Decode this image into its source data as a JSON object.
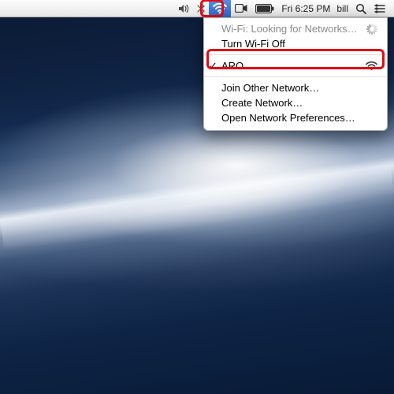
{
  "menubar": {
    "clock": "Fri 6:25 PM",
    "user": "bill"
  },
  "wifi_menu": {
    "status": "Wi-Fi: Looking for Networks…",
    "toggle": "Turn Wi-Fi Off",
    "networks": [
      {
        "name": "ARO",
        "connected": true
      }
    ],
    "join_other": "Join Other Network…",
    "create": "Create Network…",
    "prefs": "Open Network Preferences…"
  }
}
